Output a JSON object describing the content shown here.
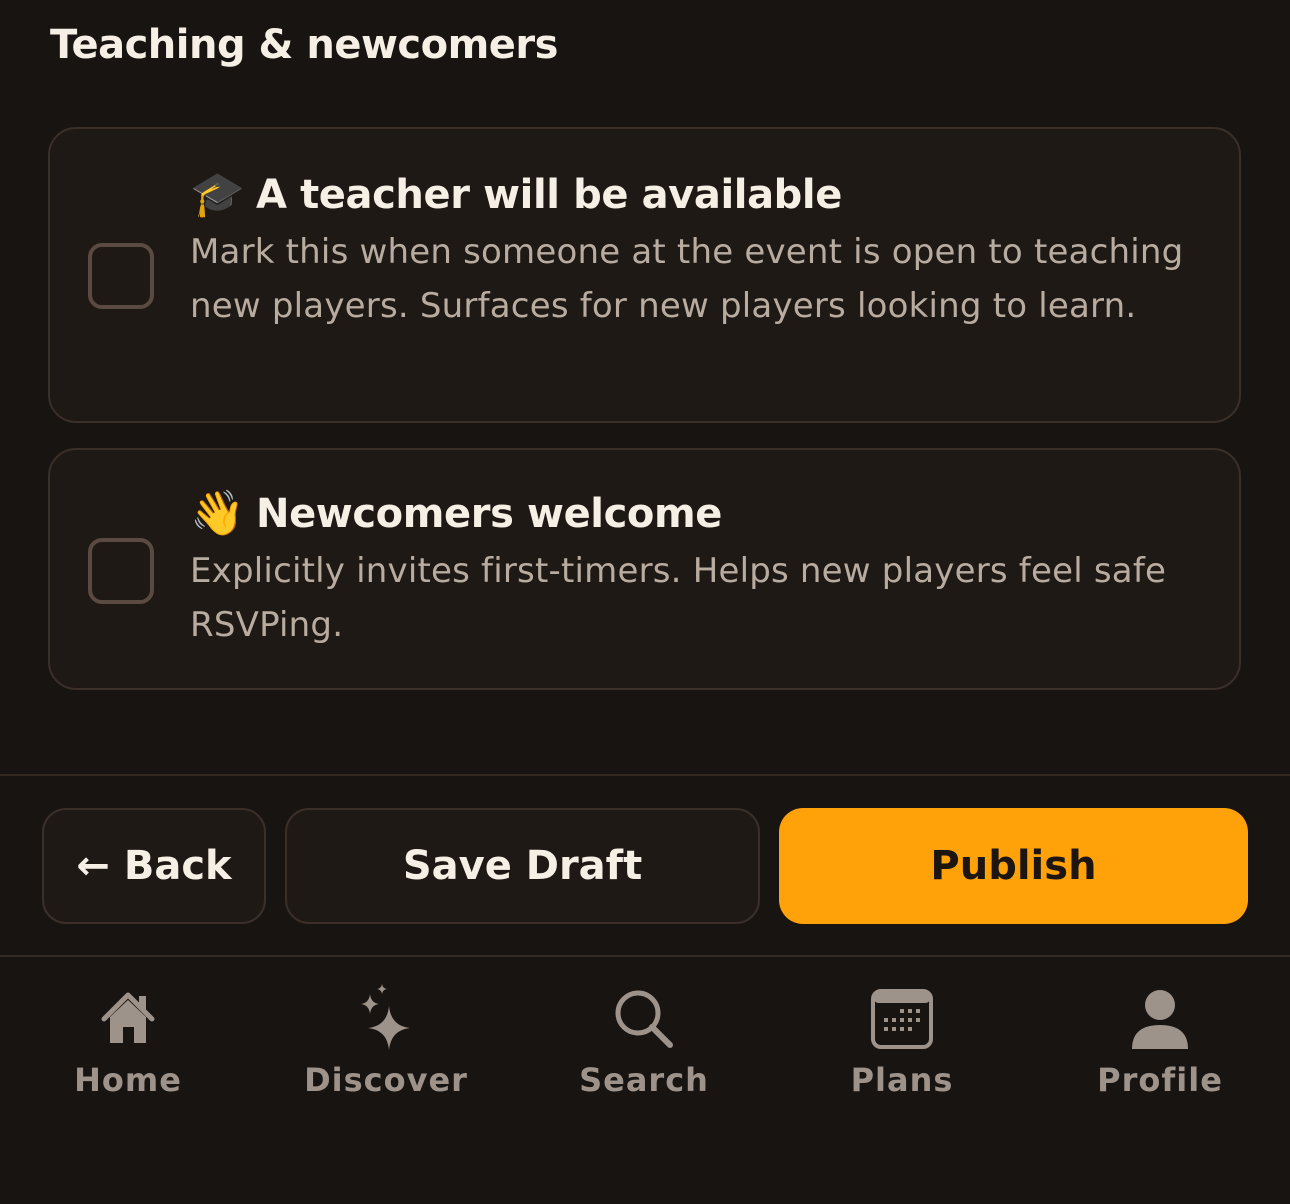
{
  "section": {
    "title": "Teaching & newcomers"
  },
  "options": [
    {
      "emoji": "🎓",
      "title": "A teacher will be available",
      "description": "Mark this when someone at the event is open to teaching new players. Surfaces for new players looking to learn.",
      "checked": false
    },
    {
      "emoji": "👋",
      "title": "Newcomers welcome",
      "description": "Explicitly invites first-timers. Helps new players feel safe RSVPing.",
      "checked": false
    }
  ],
  "actions": {
    "back_arrow": "←",
    "back_label": "Back",
    "save_draft_label": "Save Draft",
    "publish_label": "Publish"
  },
  "tabs": [
    {
      "label": "Home",
      "icon": "home-icon"
    },
    {
      "label": "Discover",
      "icon": "sparkles-icon"
    },
    {
      "label": "Search",
      "icon": "search-icon"
    },
    {
      "label": "Plans",
      "icon": "calendar-icon"
    },
    {
      "label": "Profile",
      "icon": "person-icon"
    }
  ],
  "colors": {
    "background": "#181411",
    "card": "#1f1916",
    "accent": "#ffa20a",
    "tab_inactive": "#9e938b"
  }
}
